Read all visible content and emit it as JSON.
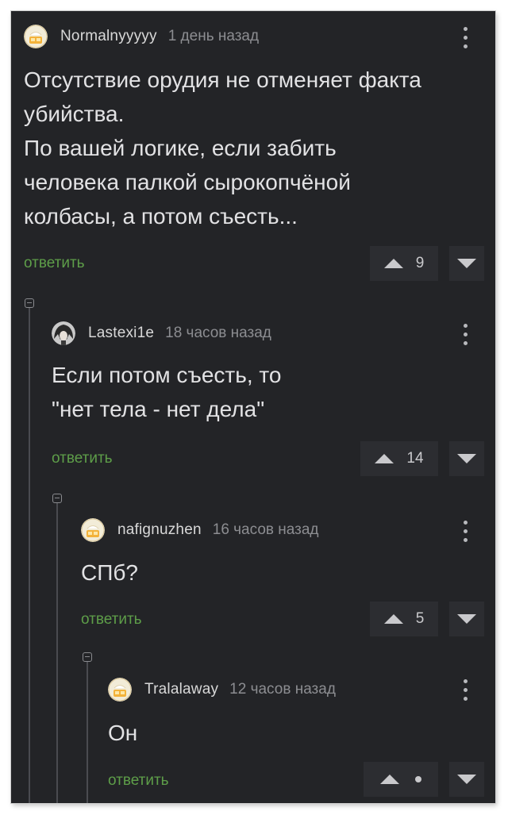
{
  "comments": [
    {
      "author": "Normalnyyyyy",
      "time": "1 день назад",
      "text_lines": [
        "Отсутствие орудия не отменяет факта",
        "убийства.",
        "По вашей логике, если забить",
        "человека палкой сырокопчёной",
        "колбасы, а потом съесть..."
      ],
      "reply_label": "ответить",
      "rating": "9",
      "avatar_icon": "cartoon-avatar-icon"
    },
    {
      "author": "Lastexi1e",
      "time": "18 часов назад",
      "text_lines": [
        "Если потом съесть, то",
        "\"нет тела - нет дела\""
      ],
      "reply_label": "ответить",
      "rating": "14",
      "avatar_icon": "anime-avatar-icon"
    },
    {
      "author": "nafignuzhen",
      "time": "16 часов назад",
      "text_lines": [
        "СПб?"
      ],
      "reply_label": "ответить",
      "rating": "5",
      "avatar_icon": "cartoon-avatar-icon"
    },
    {
      "author": "Tralalaway",
      "time": "12 часов назад",
      "text_lines": [
        "Он"
      ],
      "reply_label": "ответить",
      "rating": "",
      "avatar_icon": "cartoon-avatar-icon"
    }
  ],
  "colors": {
    "background": "#232427",
    "reply": "#5e9e49",
    "author": "#d8d8d8",
    "time": "#8c8d91",
    "text": "#e2e2e4",
    "vote_bg": "#2c2d31"
  }
}
